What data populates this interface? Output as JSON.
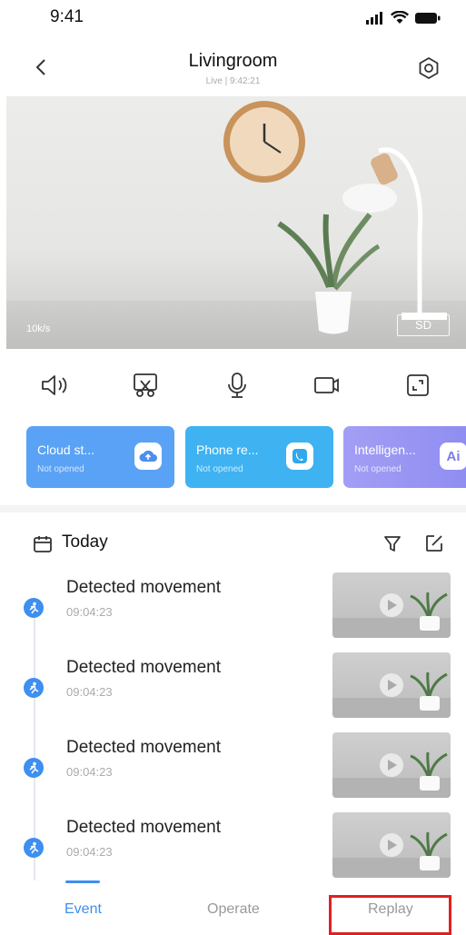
{
  "status_bar": {
    "time": "9:41"
  },
  "header": {
    "title": "Livingroom",
    "subtitle": "Live | 9:42:21"
  },
  "video": {
    "bitrate": "10k/s",
    "quality_label": "SD"
  },
  "controls": [
    {
      "name": "speaker-icon"
    },
    {
      "name": "screenshot-icon"
    },
    {
      "name": "microphone-icon"
    },
    {
      "name": "record-icon"
    },
    {
      "name": "fullscreen-icon"
    }
  ],
  "service_cards": [
    {
      "title": "Cloud st...",
      "status": "Not opened",
      "icon": "cloud-upload-icon",
      "color": "#5aa2f5"
    },
    {
      "title": "Phone re...",
      "status": "Not opened",
      "icon": "phone-icon",
      "color": "#3fb2f2"
    },
    {
      "title": "Intelligen...",
      "status": "Not opened",
      "icon": "ai-icon",
      "color": "#8d8cf0",
      "badge": "Ai"
    }
  ],
  "events_header": {
    "label": "Today"
  },
  "events": [
    {
      "title": "Detected movement",
      "time": "09:04:23"
    },
    {
      "title": "Detected movement",
      "time": "09:04:23"
    },
    {
      "title": "Detected movement",
      "time": "09:04:23"
    },
    {
      "title": "Detected movement",
      "time": "09:04:23"
    }
  ],
  "tabs": [
    {
      "label": "Event",
      "active": true
    },
    {
      "label": "Operate",
      "active": false
    },
    {
      "label": "Replay",
      "active": false
    }
  ],
  "colors": {
    "accent": "#3d8ff0",
    "highlight": "#e02020"
  }
}
